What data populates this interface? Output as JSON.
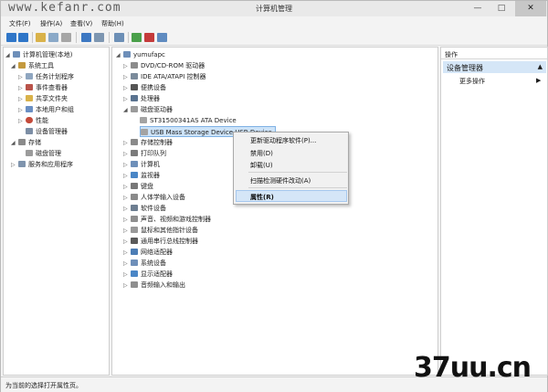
{
  "watermark": "www.kefanr.com",
  "window": {
    "title": "计算机管理",
    "min": "—",
    "max": "□",
    "close": "✕"
  },
  "menu": [
    "文件(F)",
    "操作(A)",
    "查看(V)",
    "帮助(H)"
  ],
  "left_tree": [
    {
      "label": "计算机管理(本地)",
      "icon": "computer-icon"
    },
    {
      "label": "系统工具",
      "icon": "tools-icon"
    },
    {
      "label": "任务计划程序",
      "icon": "clock-icon"
    },
    {
      "label": "事件查看器",
      "icon": "event-icon"
    },
    {
      "label": "共享文件夹",
      "icon": "folder-icon"
    },
    {
      "label": "本地用户和组",
      "icon": "users-icon"
    },
    {
      "label": "性能",
      "icon": "perf-icon"
    },
    {
      "label": "设备管理器",
      "icon": "device-icon"
    },
    {
      "label": "存储",
      "icon": "storage-icon"
    },
    {
      "label": "磁盘管理",
      "icon": "disk-icon"
    },
    {
      "label": "服务和应用程序",
      "icon": "services-icon"
    }
  ],
  "device_tree": [
    {
      "label": "yumufapc",
      "icon": "computer-icon"
    },
    {
      "label": "DVD/CD-ROM 驱动器",
      "icon": "dvd-icon"
    },
    {
      "label": "IDE ATA/ATAPI 控制器",
      "icon": "ide-icon"
    },
    {
      "label": "便携设备",
      "icon": "portable-icon"
    },
    {
      "label": "处理器",
      "icon": "cpu-icon"
    },
    {
      "label": "磁盘驱动器",
      "icon": "disk-icon"
    },
    {
      "label": "ST31500341AS ATA Device",
      "icon": "drive-icon"
    },
    {
      "label": "USB Mass Storage Device USB Device",
      "icon": "drive-icon"
    },
    {
      "label": "存储控制器",
      "icon": "storage-icon"
    },
    {
      "label": "打印队列",
      "icon": "printer-icon"
    },
    {
      "label": "计算机",
      "icon": "computer-icon"
    },
    {
      "label": "监视器",
      "icon": "monitor-icon"
    },
    {
      "label": "键盘",
      "icon": "keyboard-icon"
    },
    {
      "label": "人体学输入设备",
      "icon": "hid-icon"
    },
    {
      "label": "软件设备",
      "icon": "software-icon"
    },
    {
      "label": "声音、视频和游戏控制器",
      "icon": "sound-icon"
    },
    {
      "label": "鼠标和其他指针设备",
      "icon": "mouse-icon"
    },
    {
      "label": "通用串行总线控制器",
      "icon": "usb-icon"
    },
    {
      "label": "网络适配器",
      "icon": "network-icon"
    },
    {
      "label": "系统设备",
      "icon": "system-icon"
    },
    {
      "label": "显示适配器",
      "icon": "display-icon"
    },
    {
      "label": "音频输入和输出",
      "icon": "audio-icon"
    }
  ],
  "context_menu": [
    "更新驱动程序软件(P)...",
    "禁用(D)",
    "卸载(U)",
    "扫描检测硬件改动(A)",
    "属性(R)"
  ],
  "actions": {
    "header": "操作",
    "selected": "设备管理器",
    "more": "更多操作"
  },
  "status": "为当前的选择打开属性页。",
  "brand": "37uu.cn"
}
